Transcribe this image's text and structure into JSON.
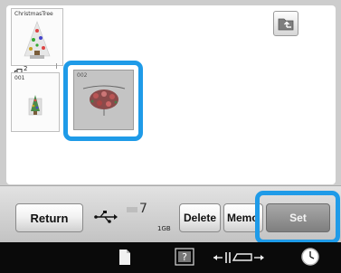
{
  "folder_thumbnail": {
    "name": "ChristmasTree",
    "count": "2"
  },
  "designs": [
    {
      "label": "001"
    },
    {
      "label": "002"
    }
  ],
  "folder_up_icon": "folder-up-icon",
  "memory": {
    "value": "7",
    "unit": "1GB"
  },
  "buttons": {
    "return": "Return",
    "delete": "Delete",
    "memory": "Memo",
    "set": "Set"
  },
  "icons": {
    "usb": "usb-icon",
    "page": "page-icon",
    "help": "help-icon",
    "presser_foot": "presser-foot-icon",
    "clock": "clock-icon"
  },
  "colors": {
    "selection": "#1f9be8",
    "set_button": "#8f8f8f"
  }
}
